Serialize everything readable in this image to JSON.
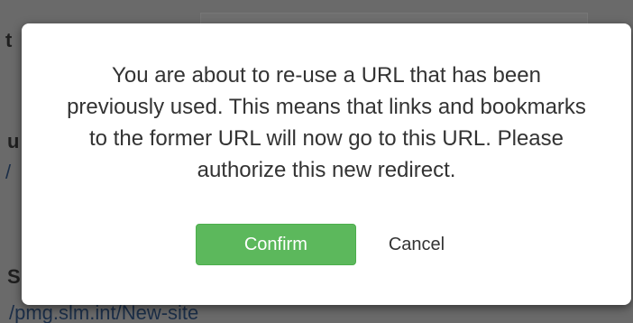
{
  "background": {
    "fragment_top": "t",
    "fragment_mid": "u",
    "fragment_lower": "S",
    "link_partial_left": "/",
    "link_bottom": "/pmg.slm.int/New-site"
  },
  "modal": {
    "message": "You are about to re-use a URL that has been previously used. This means that links and bookmarks to the former URL will now go to this URL. Please authorize this new redirect.",
    "confirm_label": "Confirm",
    "cancel_label": "Cancel"
  },
  "colors": {
    "overlay": "#5f5f5f",
    "confirm_bg": "#5cb85c",
    "text": "#333333"
  }
}
